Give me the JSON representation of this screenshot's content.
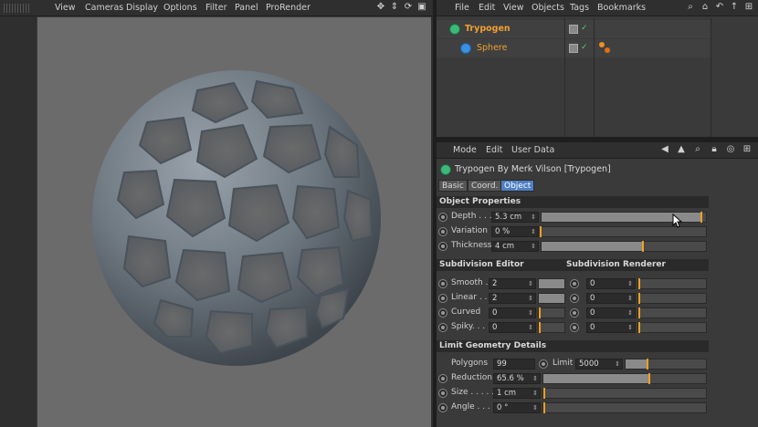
{
  "viewport": {
    "menu": [
      "View",
      "Cameras",
      "Display",
      "Options",
      "Filter",
      "Panel",
      "ProRender"
    ],
    "nav_icons": [
      "move-icon",
      "zoom-icon",
      "rotate-icon",
      "maximize-icon"
    ]
  },
  "object_manager": {
    "menu": [
      "File",
      "Edit",
      "View",
      "Objects",
      "Tags",
      "Bookmarks"
    ],
    "objects": [
      {
        "name": "Trypogen",
        "icon": "trypogen-icon"
      },
      {
        "name": "Sphere",
        "icon": "sphere-icon"
      }
    ]
  },
  "attribute_manager": {
    "menu": [
      "Mode",
      "Edit",
      "User Data"
    ],
    "title": "Trypogen By Merk Vilson [Trypogen]",
    "tabs": [
      "Basic",
      "Coord.",
      "Object"
    ],
    "active_tab": "Object",
    "object_properties": {
      "header": "Object Properties",
      "rows": [
        {
          "label": "Depth . . .",
          "value": "5.3 cm",
          "fill": 0.98
        },
        {
          "label": "Variation",
          "value": "0 %",
          "fill": 0.0
        },
        {
          "label": "Thickness",
          "value": "4 cm",
          "fill": 0.62
        }
      ]
    },
    "subdivision": {
      "editor_header": "Subdivision Editor",
      "renderer_header": "Subdivision Renderer",
      "rows": [
        {
          "label": "Smooth .",
          "editor_value": "2",
          "renderer_value": "0"
        },
        {
          "label": "Linear . .",
          "editor_value": "2",
          "renderer_value": "0"
        },
        {
          "label": "Curved",
          "editor_value": "0",
          "renderer_value": "0"
        },
        {
          "label": "Spiky. . .",
          "editor_value": "0",
          "renderer_value": "0"
        }
      ]
    },
    "limit_geometry": {
      "header": "Limit Geometry Details",
      "polygons_label": "Polygons",
      "polygons_value": "99",
      "limit_label": "Limit",
      "limit_value": "5000",
      "reduction_label": "Reduction",
      "reduction_value": "65.6 %",
      "reduction_fill": 0.656,
      "size_label": "Size . . . . .",
      "size_value": "1 cm",
      "angle_label": "Angle . . . .",
      "angle_value": "0 °"
    }
  },
  "colors": {
    "accent_orange": "#f0a020",
    "tab_active": "#4e7fc4",
    "object_name": "#f0a030",
    "viewport_bg": "#6b6b6b"
  }
}
